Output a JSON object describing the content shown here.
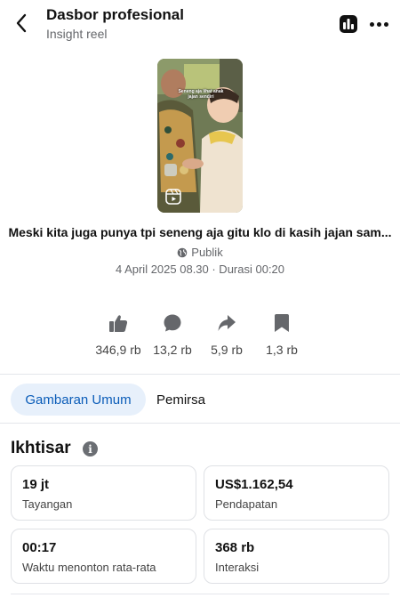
{
  "header": {
    "title": "Dasbor profesional",
    "subtitle": "Insight reel",
    "back_icon": "chevron-left-icon",
    "insights_icon": "bar-chart-icon",
    "more_icon": "more-horizontal-icon"
  },
  "post": {
    "thumbnail_overlay_text": "Seneng aja lihat anak jajan sendiri",
    "caption": "Meski kita juga punya tpi seneng aja gitu klo di kasih jajan sam...",
    "privacy": "Publik",
    "date_line": "4 April 2025 08.30 · Durasi 00:20"
  },
  "stats": [
    {
      "icon": "like-icon",
      "value": "346,9 rb"
    },
    {
      "icon": "comment-icon",
      "value": "13,2 rb"
    },
    {
      "icon": "share-icon",
      "value": "5,9 rb"
    },
    {
      "icon": "bookmark-icon",
      "value": "1,3 rb"
    }
  ],
  "tabs": {
    "active": "Gambaran Umum",
    "other": "Pemirsa"
  },
  "overview": {
    "title": "Ikhtisar",
    "cards": [
      {
        "value": "19 jt",
        "label": "Tayangan"
      },
      {
        "value": "US$1.162,54",
        "label": "Pendapatan"
      },
      {
        "value": "00:17",
        "label": "Waktu menonton rata-rata"
      },
      {
        "value": "368 rb",
        "label": "Interaksi"
      }
    ]
  },
  "colors": {
    "accent": "#0a5cb8",
    "tab_active_bg": "#e7f0fb",
    "muted_text": "#65676b"
  }
}
